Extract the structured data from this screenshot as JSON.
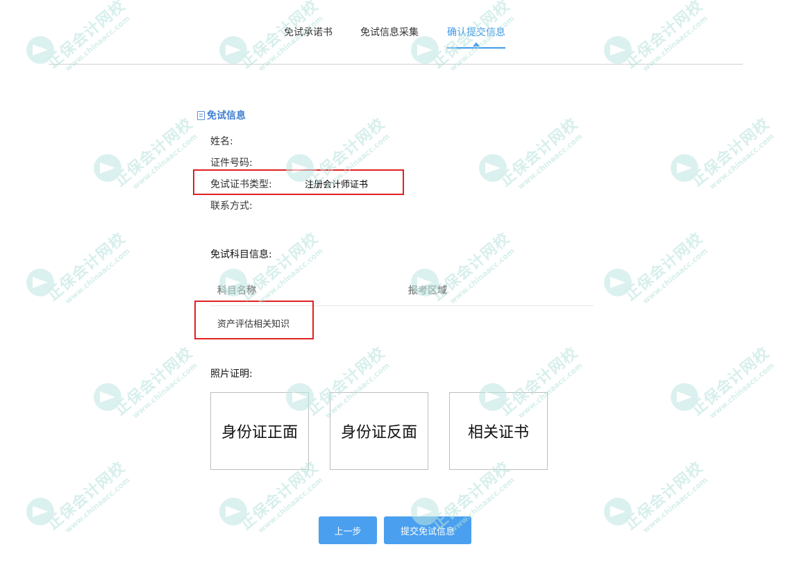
{
  "tabs": [
    {
      "label": "免试承诺书",
      "active": false
    },
    {
      "label": "免试信息采集",
      "active": false
    },
    {
      "label": "确认提交信息",
      "active": true
    }
  ],
  "section": {
    "title": "免试信息",
    "icon": "document-icon"
  },
  "fields": {
    "name_label": "姓名:",
    "id_label": "证件号码:",
    "cert_type_label": "免试证书类型:",
    "cert_type_value": "注册会计师证书",
    "contact_label": "联系方式:"
  },
  "subjects": {
    "label": "免试科目信息:",
    "columns": [
      "科目名称",
      "报考区域"
    ],
    "rows": [
      [
        "资产评估相关知识",
        ""
      ]
    ]
  },
  "photos": {
    "label": "照片证明:",
    "items": [
      "身份证正面",
      "身份证反面",
      "相关证书"
    ]
  },
  "buttons": {
    "prev": "上一步",
    "submit": "提交免试信息"
  },
  "watermark": {
    "text": "正保会计网校",
    "url": "www.chinaacc.com"
  },
  "colors": {
    "accent": "#3f9ae8",
    "button": "#4aa0ef",
    "highlight_box": "#e02020"
  }
}
